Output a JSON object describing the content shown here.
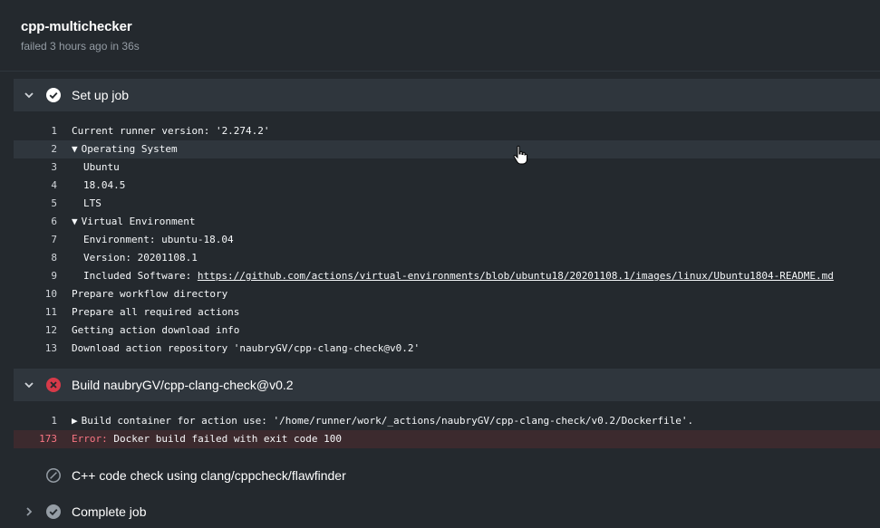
{
  "job": {
    "title": "cpp-multichecker",
    "status": "failed 3 hours ago in 36s"
  },
  "steps": [
    {
      "label": "Set up job",
      "state": "success",
      "expanded": true,
      "lines": [
        {
          "n": "1",
          "text": "Current runner version: '2.274.2'"
        },
        {
          "n": "2",
          "text": "Operating System",
          "group": "open"
        },
        {
          "n": "3",
          "text": "Ubuntu",
          "indent": true
        },
        {
          "n": "4",
          "text": "18.04.5",
          "indent": true
        },
        {
          "n": "5",
          "text": "LTS",
          "indent": true
        },
        {
          "n": "6",
          "text": "Virtual Environment",
          "group": "open"
        },
        {
          "n": "7",
          "text": "Environment: ubuntu-18.04",
          "indent": true
        },
        {
          "n": "8",
          "text": "Version: 20201108.1",
          "indent": true
        },
        {
          "n": "9",
          "text": "Included Software: ",
          "link": "https://github.com/actions/virtual-environments/blob/ubuntu18/20201108.1/images/linux/Ubuntu1804-README.md",
          "indent": true
        },
        {
          "n": "10",
          "text": "Prepare workflow directory"
        },
        {
          "n": "11",
          "text": "Prepare all required actions"
        },
        {
          "n": "12",
          "text": "Getting action download info"
        },
        {
          "n": "13",
          "text": "Download action repository 'naubryGV/cpp-clang-check@v0.2'"
        }
      ]
    },
    {
      "label": "Build naubryGV/cpp-clang-check@v0.2",
      "state": "failure",
      "expanded": true,
      "lines": [
        {
          "n": "1",
          "text": "Build container for action use: '/home/runner/work/_actions/naubryGV/cpp-clang-check/v0.2/Dockerfile'.",
          "group": "closed"
        },
        {
          "n": "173",
          "keyword": "Error:",
          "text": " Docker build failed with exit code 100",
          "error": true
        }
      ]
    },
    {
      "label": "C++ code check using clang/cppcheck/flawfinder",
      "state": "skipped",
      "expanded": false
    },
    {
      "label": "Complete job",
      "state": "success-muted",
      "expanded": false
    }
  ],
  "colors": {
    "background": "#24292e",
    "step_bg": "#2f363d",
    "success": "#ffffff",
    "failure": "#d73a49",
    "muted": "#959da5"
  }
}
